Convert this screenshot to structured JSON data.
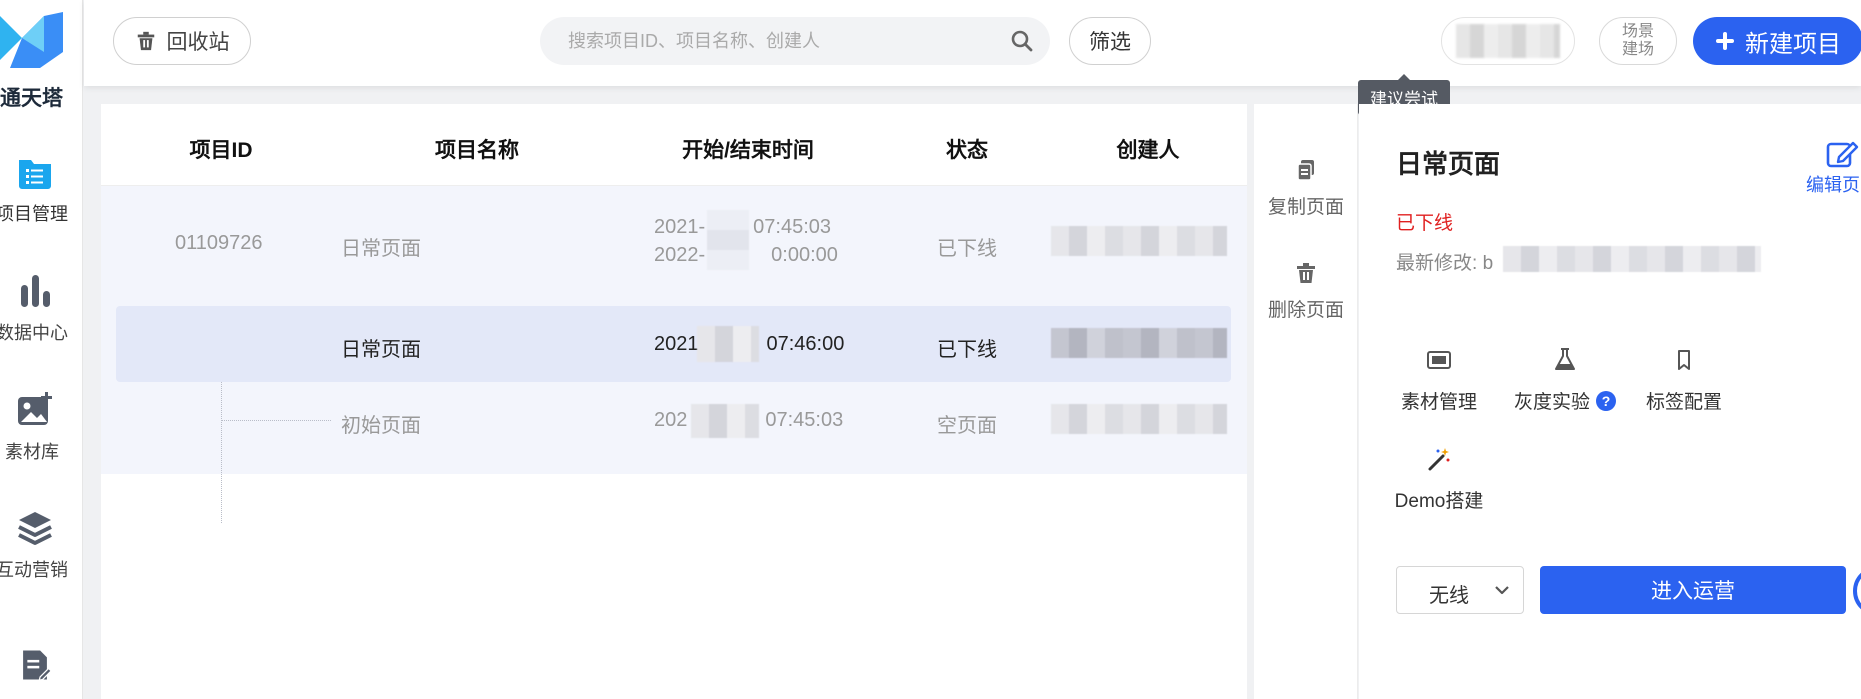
{
  "app": {
    "name": "通天塔"
  },
  "sidebar": {
    "items": [
      {
        "label": "项目管理",
        "icon": "project-icon",
        "active": true
      },
      {
        "label": "数据中心",
        "icon": "bar-chart-icon"
      },
      {
        "label": "素材库",
        "icon": "image-icon"
      },
      {
        "label": "互动营销",
        "icon": "layers-icon"
      },
      {
        "label": "",
        "icon": "document-edit-icon"
      }
    ]
  },
  "topbar": {
    "recycle_label": "回收站",
    "search_placeholder": "搜索项目ID、项目名称、创建人",
    "filter_label": "筛选",
    "tooltip": "建议尝试",
    "scene_label_line1": "场景",
    "scene_label_line2": "建场",
    "new_project_label": "新建项目"
  },
  "table": {
    "columns": [
      "项目ID",
      "项目名称",
      "开始/结束时间",
      "状态",
      "创建人"
    ],
    "rows": [
      {
        "id": "01109726",
        "name": "日常页面",
        "time_start": "2021-",
        "time_start_suffix": "07:45:03",
        "time_end": "2022-",
        "time_end_suffix": "0:00:00",
        "status": "已下线",
        "parent": true
      },
      {
        "id": "",
        "name": "日常页面",
        "time_start": "2021",
        "time_start_suffix": "07:46:00",
        "status": "已下线",
        "selected": true
      },
      {
        "id": "",
        "name": "初始页面",
        "time_start": "202",
        "time_start_suffix": "07:45:03",
        "status": "空页面"
      }
    ]
  },
  "actions": [
    {
      "label": "复制页面",
      "icon": "copy-icon"
    },
    {
      "label": "删除页面",
      "icon": "trash-icon"
    }
  ],
  "detail": {
    "title": "日常页面",
    "edit_label": "编辑页面",
    "status": "已下线",
    "modified_label": "最新修改:",
    "modified_prefix": "b",
    "tools": [
      {
        "label": "素材管理",
        "icon": "material-icon"
      },
      {
        "label": "灰度实验",
        "icon": "flask-icon",
        "help": "?"
      },
      {
        "label": "标签配置",
        "icon": "bookmark-icon"
      },
      {
        "label": "Demo搭建",
        "icon": "magic-wand-icon"
      }
    ],
    "env_value": "无线",
    "enter_label": "进入运营"
  },
  "colors": {
    "primary": "#2b62f0",
    "danger": "#e02020",
    "row_group_bg": "#f3f5fc",
    "row_selected_bg": "#e3e8f8"
  }
}
